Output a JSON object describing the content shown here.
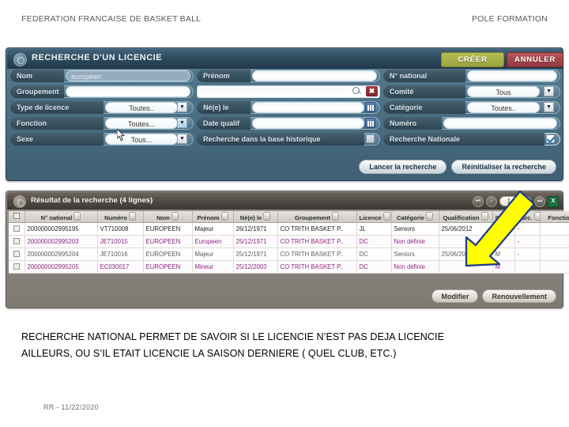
{
  "slide": {
    "header_left": "FEDERATION FRANCAISE DE BASKET BALL",
    "header_right": "POLE FORMATION",
    "caption_line1": "RECHERCHE NATIONAL PERMET DE SAVOIR SI LE LICENCIE N’EST PAS DEJA LICENCIE",
    "caption_line2": "AILLEURS, OU S’IL ETAIT LICENCIE LA SAISON DERNIERE ( QUEL CLUB, ETC.)",
    "footer": "RR - 11/22/2020"
  },
  "search_panel": {
    "title": "RECHERCHE D'UN LICENCIE",
    "create_label": "CRÉER",
    "cancel_label": "ANNULER",
    "fields": {
      "nom": {
        "label": "Nom",
        "value": "européen"
      },
      "prenom": {
        "label": "Prénom",
        "value": ""
      },
      "n_national": {
        "label": "N° national",
        "value": ""
      },
      "groupement": {
        "label": "Groupement",
        "value": ""
      },
      "groupement_search": {
        "value": ""
      },
      "comite": {
        "label": "Comité",
        "value": "Tous"
      },
      "type_licence": {
        "label": "Type de licence",
        "value": "Toutes.."
      },
      "nee_le": {
        "label": "Né(e) le",
        "value": ""
      },
      "categorie": {
        "label": "Catégorie",
        "value": "Toutes.."
      },
      "fonction": {
        "label": "Fonction",
        "value": "Toutes..."
      },
      "date_qualif": {
        "label": "Date qualif",
        "value": ""
      },
      "numero": {
        "label": "Numéro",
        "value": ""
      },
      "sexe": {
        "label": "Sexe",
        "value": "Tous..."
      },
      "base_historique": {
        "label": "Recherche dans la base historique",
        "checked": false
      },
      "recherche_nationale": {
        "label": "Recherche Nationale",
        "checked": true
      }
    },
    "buttons": {
      "search": "Lancer la recherche",
      "reset": "Réinitialiser la recherche"
    }
  },
  "results_panel": {
    "title": "Résultat de la recherche",
    "count_label": "(4 lignes)",
    "pager": {
      "first": "⏮",
      "prev": "‹",
      "page": "1",
      "next": "›",
      "last": "⏭",
      "export": "X"
    },
    "columns": [
      "",
      "N° national",
      "Numéro",
      "Nom",
      "Prénom",
      "Né(e) le",
      "Groupement",
      "Licence",
      "Catégorie",
      "Qualification",
      "Sexe",
      "Surc.",
      "Fonctions"
    ],
    "rows": [
      {
        "n_national": "200000002995195",
        "numero": "VT710008",
        "nom": "EUROPEEN",
        "prenom": "Majeur",
        "nee_le": "26/12/1971",
        "groupement": "CO TRITH BASKET P..",
        "licence": "JL",
        "categorie": "Seniors",
        "qualification": "25/06/2012",
        "sexe": "M",
        "surc": "-",
        "fonctions": ""
      },
      {
        "n_national": "200000002995203",
        "numero": "JE710015",
        "nom": "EUROPEEN",
        "prenom": "Europeen",
        "nee_le": "25/12/1971",
        "groupement": "CO TRITH BASKET P..",
        "licence": "DC",
        "categorie": "Non définie",
        "qualification": "",
        "sexe": "M",
        "surc": "-",
        "fonctions": ""
      },
      {
        "n_national": "200000002995204",
        "numero": "JE710016",
        "nom": "EUROPEEN",
        "prenom": "Majeur",
        "nee_le": "25/12/1971",
        "groupement": "CO TRITH BASKET P..",
        "licence": "DC",
        "categorie": "Seniors",
        "qualification": "25/06/2012",
        "sexe": "M",
        "surc": "-",
        "fonctions": ""
      },
      {
        "n_national": "200000002995205",
        "numero": "EC030017",
        "nom": "EUROPEEN",
        "prenom": "Mineur",
        "nee_le": "25/12/2003",
        "groupement": "CO TRITH BASKET P..",
        "licence": "DC",
        "categorie": "Non définie",
        "qualification": "",
        "sexe": "M",
        "surc": "",
        "fonctions": ""
      }
    ],
    "buttons": {
      "modify": "Modifier",
      "renew": "Renouvellement"
    }
  },
  "colors": {
    "panel_blue": "#4f7286",
    "panel_grey": "#8d8881",
    "create_green": "#9aa33d",
    "cancel_red": "#93393e",
    "arrow_yellow": "#ffff00",
    "row_magenta": "#8c2a7e"
  }
}
